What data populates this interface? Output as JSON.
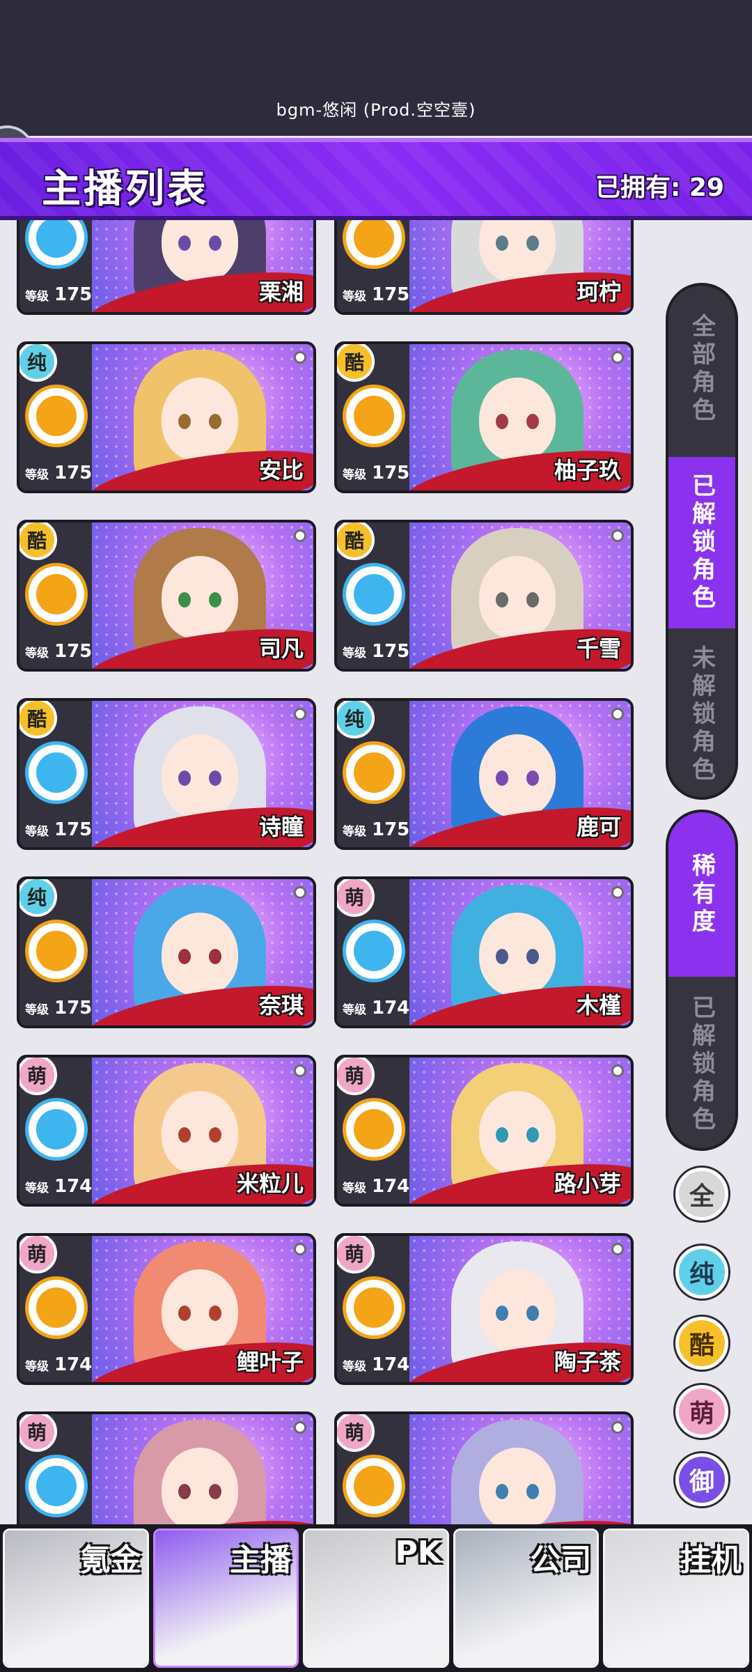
{
  "bgm": "bgm-悠闲 (Prod.空空壹)",
  "header": {
    "title": "主播列表",
    "owned": "已拥有: 29"
  },
  "cards": [
    {
      "name": "栗湘",
      "level": "175",
      "level_label": "等级",
      "attr": "",
      "attr_color": "#e8e8e8",
      "team_color": "#3fb5f0",
      "hair": "#4d3f69",
      "eye": "#6b4ba8"
    },
    {
      "name": "珂柠",
      "level": "175",
      "level_label": "等级",
      "attr": "",
      "attr_color": "#e8e8e8",
      "team_color": "#f3a417",
      "hair": "#d8dad9",
      "eye": "#5d7c8a"
    },
    {
      "name": "安比",
      "level": "175",
      "level_label": "等级",
      "attr": "纯",
      "attr_color": "#5fd0e8",
      "team_color": "#f3a417",
      "hair": "#f0c36a",
      "eye": "#9a6b2e"
    },
    {
      "name": "柚子玖",
      "level": "175",
      "level_label": "等级",
      "attr": "酷",
      "attr_color": "#f5c02a",
      "team_color": "#f3a417",
      "hair": "#5cb79a",
      "eye": "#a23a4a"
    },
    {
      "name": "司凡",
      "level": "175",
      "level_label": "等级",
      "attr": "酷",
      "attr_color": "#f5c02a",
      "team_color": "#f3a417",
      "hair": "#b07a4a",
      "eye": "#3c8f4a"
    },
    {
      "name": "千雪",
      "level": "175",
      "level_label": "等级",
      "attr": "酷",
      "attr_color": "#f5c02a",
      "team_color": "#3fb5f0",
      "hair": "#d9cfc0",
      "eye": "#6a6a6a"
    },
    {
      "name": "诗瞳",
      "level": "175",
      "level_label": "等级",
      "attr": "酷",
      "attr_color": "#f5c02a",
      "team_color": "#3fb5f0",
      "hair": "#dfe0ea",
      "eye": "#6c4ba8"
    },
    {
      "name": "鹿可",
      "level": "175",
      "level_label": "等级",
      "attr": "纯",
      "attr_color": "#5fd0e8",
      "team_color": "#f3a417",
      "hair": "#2d7bd8",
      "eye": "#7a4ab0"
    },
    {
      "name": "奈琪",
      "level": "175",
      "level_label": "等级",
      "attr": "纯",
      "attr_color": "#5fd0e8",
      "team_color": "#f3a417",
      "hair": "#4aa7e8",
      "eye": "#9a3040"
    },
    {
      "name": "木槿",
      "level": "174",
      "level_label": "等级",
      "attr": "萌",
      "attr_color": "#f0a6c6",
      "team_color": "#3fb5f0",
      "hair": "#3fb0e0",
      "eye": "#4a5a8a"
    },
    {
      "name": "米粒儿",
      "level": "174",
      "level_label": "等级",
      "attr": "萌",
      "attr_color": "#f0a6c6",
      "team_color": "#3fb5f0",
      "hair": "#f5c98e",
      "eye": "#b2402a"
    },
    {
      "name": "路小芽",
      "level": "174",
      "level_label": "等级",
      "attr": "萌",
      "attr_color": "#f0a6c6",
      "team_color": "#f3a417",
      "hair": "#f3cf78",
      "eye": "#2f9ab0"
    },
    {
      "name": "鲤叶子",
      "level": "174",
      "level_label": "等级",
      "attr": "萌",
      "attr_color": "#f0a6c6",
      "team_color": "#f3a417",
      "hair": "#f08a72",
      "eye": "#b2402a"
    },
    {
      "name": "陶子茶",
      "level": "174",
      "level_label": "等级",
      "attr": "萌",
      "attr_color": "#f0a6c6",
      "team_color": "#f3a417",
      "hair": "#e8e8ee",
      "eye": "#3f7fb0"
    },
    {
      "name": "",
      "level": "",
      "level_label": "",
      "attr": "萌",
      "attr_color": "#f0a6c6",
      "team_color": "#3fb5f0",
      "hair": "#d89aa8",
      "eye": "#8a3a4a"
    },
    {
      "name": "",
      "level": "",
      "level_label": "",
      "attr": "萌",
      "attr_color": "#f0a6c6",
      "team_color": "#f3a417",
      "hair": "#b0aee0",
      "eye": "#3f7fb0"
    }
  ],
  "filters": {
    "all": "全部角色",
    "unlocked": "已解锁角色",
    "locked": "未解锁角色",
    "rarity": "稀有度",
    "rarity_unlocked": "已解锁角色"
  },
  "attr_filters": [
    {
      "label": "全",
      "bg": "#d8d8d8",
      "fg": "#3a3a3a"
    },
    {
      "label": "纯",
      "bg": "#5fd0e8",
      "fg": "#1c3a52"
    },
    {
      "label": "酷",
      "bg": "#f5c02a",
      "fg": "#4a2f05"
    },
    {
      "label": "萌",
      "bg": "#f0a6c6",
      "fg": "#5a1d3a"
    },
    {
      "label": "御",
      "bg": "#7a4ee8",
      "fg": "#ffffff"
    }
  ],
  "bottom_nav": [
    {
      "label": "氪金",
      "bg": "#b9b9c2"
    },
    {
      "label": "主播",
      "bg": "#8f5cf0"
    },
    {
      "label": "PK",
      "bg": "#c8c8cc"
    },
    {
      "label": "公司",
      "bg": "#a9b0bd"
    },
    {
      "label": "挂机",
      "bg": "#d7d7dc"
    }
  ]
}
